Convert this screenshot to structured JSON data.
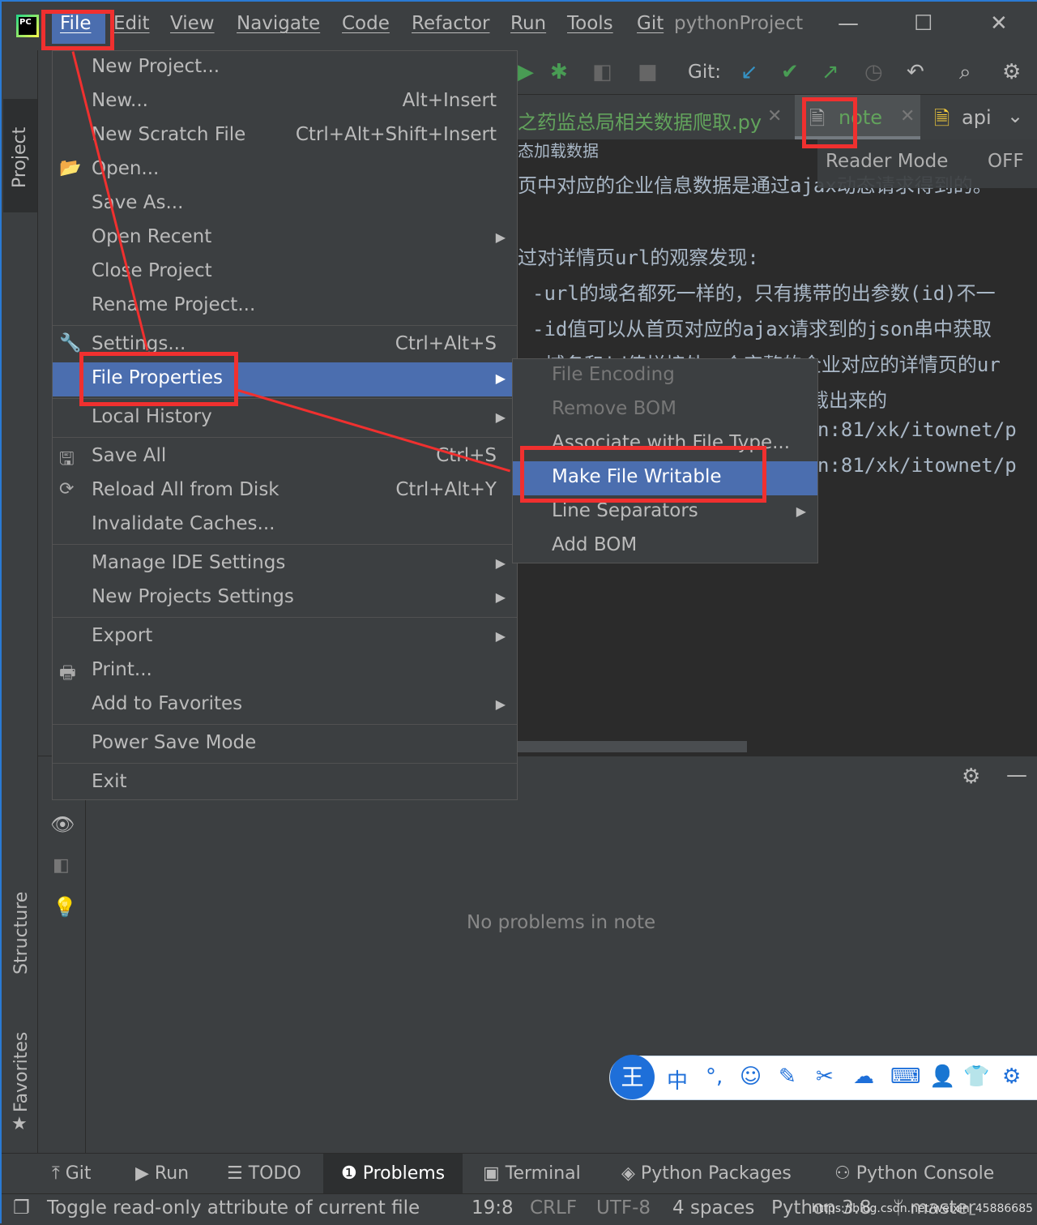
{
  "title_bar": {
    "menus": [
      "File",
      "Edit",
      "View",
      "Navigate",
      "Code",
      "Refactor",
      "Run",
      "Tools",
      "Git"
    ],
    "project_name": "pythonProject",
    "logo_text": "PC"
  },
  "toolbar": {
    "git_label": "Git:"
  },
  "tabs": [
    {
      "label": "之药监总局相关数据爬取.py"
    },
    {
      "label": "note",
      "active": true
    },
    {
      "label": "api"
    }
  ],
  "reader_mode": {
    "label": "Reader Mode",
    "state": "OFF"
  },
  "editor_lines": [
    "态加载数据",
    "页中对应的企业信息数据是通过ajax动态请求得到的。",
    "过对详情页url的观察发现:",
    "-url的域名都死一样的，只有携带的出参数(id)不一",
    "-id值可以从首页对应的ajax请求到的json串中获取",
    "域名和id值拼接处一个完整的企业对应的详情页的ur",
    "载出来的",
    "n:81/xk/itownet/p",
    "n:81/xk/itownet/p"
  ],
  "file_menu": [
    {
      "label": "New Project...",
      "shortcut": ""
    },
    {
      "label": "New...",
      "shortcut": "Alt+Insert"
    },
    {
      "label": "New Scratch File",
      "shortcut": "Ctrl+Alt+Shift+Insert"
    },
    {
      "label": "Open...",
      "shortcut": ""
    },
    {
      "label": "Save As...",
      "shortcut": ""
    },
    {
      "label": "Open Recent",
      "shortcut": ""
    },
    {
      "label": "Close Project",
      "shortcut": ""
    },
    {
      "label": "Rename Project...",
      "shortcut": ""
    },
    {
      "label": "Settings...",
      "shortcut": "Ctrl+Alt+S"
    },
    {
      "label": "File Properties",
      "shortcut": ""
    },
    {
      "label": "Local History",
      "shortcut": ""
    },
    {
      "label": "Save All",
      "shortcut": "Ctrl+S"
    },
    {
      "label": "Reload All from Disk",
      "shortcut": "Ctrl+Alt+Y"
    },
    {
      "label": "Invalidate Caches...",
      "shortcut": ""
    },
    {
      "label": "Manage IDE Settings",
      "shortcut": ""
    },
    {
      "label": "New Projects Settings",
      "shortcut": ""
    },
    {
      "label": "Export",
      "shortcut": ""
    },
    {
      "label": "Print...",
      "shortcut": ""
    },
    {
      "label": "Add to Favorites",
      "shortcut": ""
    },
    {
      "label": "Power Save Mode",
      "shortcut": ""
    },
    {
      "label": "Exit",
      "shortcut": ""
    }
  ],
  "file_properties_submenu": [
    "File Encoding",
    "Remove BOM",
    "Associate with File Type...",
    "Make File Writable",
    "Line Separators",
    "Add BOM"
  ],
  "side_tabs": {
    "project": "Project",
    "structure": "Structure",
    "favorites": "Favorites"
  },
  "problems": {
    "empty_text": "No problems in note"
  },
  "tool_windows": [
    "Git",
    "Run",
    "TODO",
    "Problems",
    "Terminal",
    "Python Packages",
    "Python Console"
  ],
  "status_bar": {
    "message": "Toggle read-only attribute of current file",
    "position": "19:8",
    "line_separator": "CRLF",
    "encoding": "UTF-8",
    "indent": "4 spaces",
    "interpreter": "Python 3.8",
    "branch": "master",
    "watermark": "https://blog.csdn.net/weixin_45886685"
  },
  "ime_toolbar": {
    "logo": "王",
    "mode": "中"
  },
  "colors": {
    "selection": "#4b6eaf",
    "annotation": "#f0302f",
    "background": "#3c3f41",
    "editor": "#2b2b2b"
  }
}
